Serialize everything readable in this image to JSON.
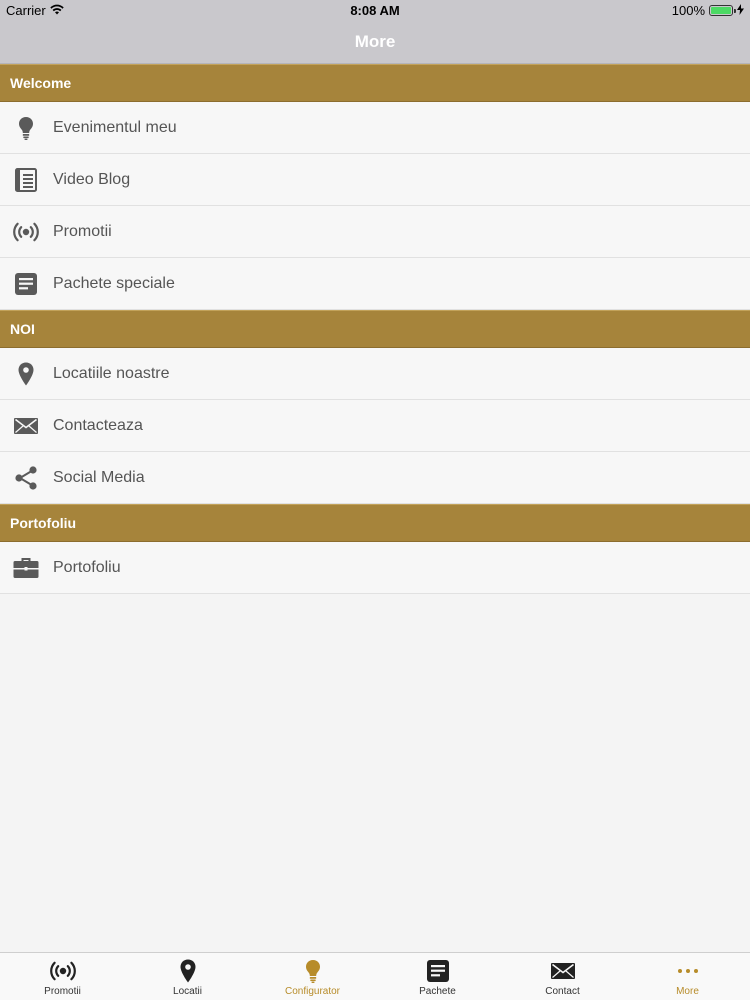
{
  "status_bar": {
    "carrier": "Carrier",
    "time": "8:08 AM",
    "battery_text": "100%",
    "battery_level": 1.0
  },
  "nav": {
    "title": "More"
  },
  "sections": [
    {
      "header": "Welcome",
      "items": [
        {
          "label": "Evenimentul meu",
          "icon": "lightbulb-icon"
        },
        {
          "label": "Video Blog",
          "icon": "notebook-icon"
        },
        {
          "label": "Promotii",
          "icon": "broadcast-icon"
        },
        {
          "label": "Pachete speciale",
          "icon": "document-icon"
        }
      ]
    },
    {
      "header": "NOI",
      "items": [
        {
          "label": "Locatiile noastre",
          "icon": "location-pin-icon"
        },
        {
          "label": "Contacteaza",
          "icon": "envelope-icon"
        },
        {
          "label": "Social Media",
          "icon": "share-icon"
        }
      ]
    },
    {
      "header": "Portofoliu",
      "items": [
        {
          "label": "Portofoliu",
          "icon": "briefcase-icon"
        }
      ]
    }
  ],
  "tabs": [
    {
      "label": "Promotii",
      "icon": "broadcast-icon",
      "active": false
    },
    {
      "label": "Locatii",
      "icon": "location-pin-icon",
      "active": false
    },
    {
      "label": "Configurator",
      "icon": "lightbulb-icon",
      "active": true
    },
    {
      "label": "Pachete",
      "icon": "document-icon",
      "active": false
    },
    {
      "label": "Contact",
      "icon": "envelope-icon",
      "active": false
    },
    {
      "label": "More",
      "icon": "more-dots-icon",
      "active": false
    }
  ],
  "colors": {
    "section_header": "#a6843b",
    "active_tab": "#b78c2a",
    "icon_gray": "#5a5a5a"
  }
}
